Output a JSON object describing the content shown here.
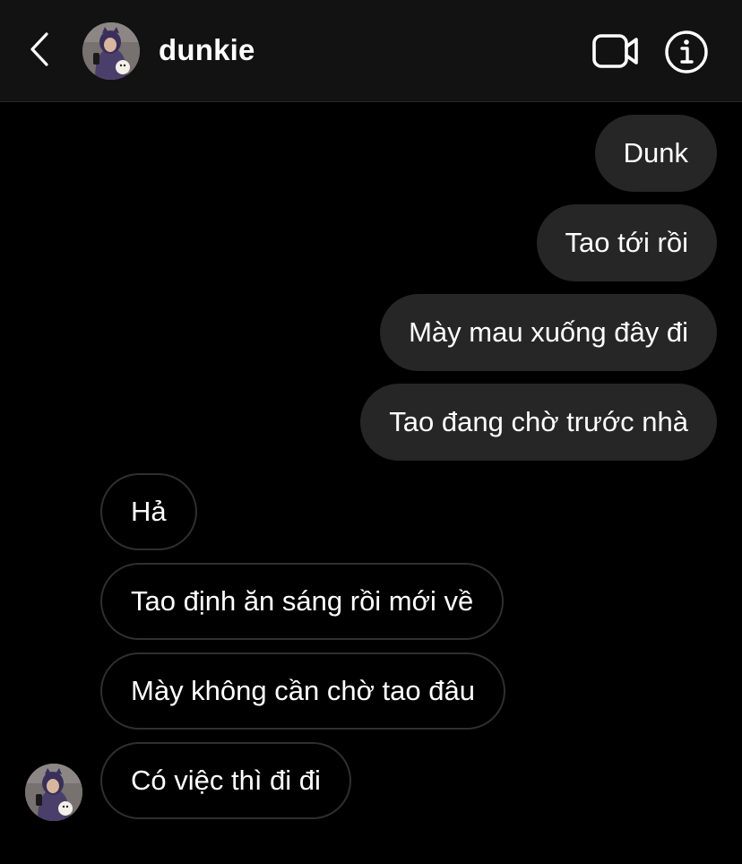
{
  "header": {
    "username": "dunkie",
    "back_icon": "chevron-left-icon",
    "video_icon": "video-camera-icon",
    "info_icon": "info-icon"
  },
  "messages": [
    {
      "direction": "sent",
      "text": "Dunk"
    },
    {
      "direction": "sent",
      "text": "Tao tới rồi"
    },
    {
      "direction": "sent",
      "text": "Mày mau xuống đây đi"
    },
    {
      "direction": "sent",
      "text": "Tao đang chờ trước nhà"
    },
    {
      "direction": "received",
      "text": "Hả"
    },
    {
      "direction": "received",
      "text": "Tao định ăn sáng rồi mới về"
    },
    {
      "direction": "received",
      "text": "Mày không cần chờ tao đâu"
    },
    {
      "direction": "received",
      "text": "Có việc thì đi đi"
    }
  ],
  "colors": {
    "background": "#000000",
    "header_bg": "#121212",
    "sent_bubble": "#262626",
    "received_border": "#2f2f2f",
    "text": "#ffffff"
  }
}
